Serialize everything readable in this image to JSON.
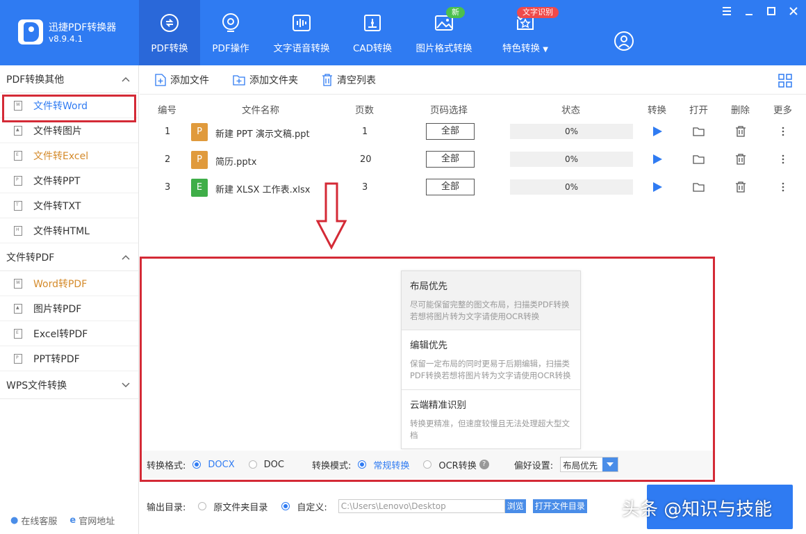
{
  "app": {
    "name": "迅捷PDF转换器",
    "version": "v8.9.4.1"
  },
  "nav": [
    {
      "label": "PDF转换",
      "icon": "pdf-convert-icon",
      "active": true
    },
    {
      "label": "PDF操作",
      "icon": "pdf-operate-icon"
    },
    {
      "label": "文字语音转换",
      "icon": "voice-wave-icon"
    },
    {
      "label": "CAD转换",
      "icon": "cad-icon"
    },
    {
      "label": "图片格式转换",
      "icon": "image-icon",
      "badge": "新"
    },
    {
      "label": "特色转换",
      "icon": "feature-icon",
      "badge": "文字识别"
    }
  ],
  "sidebar": {
    "group1": "PDF转换其他",
    "group1_items": [
      "文件转Word",
      "文件转图片",
      "文件转Excel",
      "文件转PPT",
      "文件转TXT",
      "文件转HTML"
    ],
    "group2": "文件转PDF",
    "group2_items": [
      "Word转PDF",
      "图片转PDF",
      "Excel转PDF",
      "PPT转PDF"
    ],
    "group3": "WPS文件转换",
    "bottom": {
      "service": "在线客服",
      "website": "官网地址"
    }
  },
  "toolbar": {
    "add_file": "添加文件",
    "add_folder": "添加文件夹",
    "clear": "清空列表"
  },
  "table": {
    "headers": [
      "编号",
      "文件名称",
      "页数",
      "页码选择",
      "状态",
      "转换",
      "打开",
      "删除",
      "更多"
    ],
    "rows": [
      {
        "no": "1",
        "type": "P",
        "name": "新建 PPT 演示文稿.ppt",
        "pages": "1",
        "range": "全部",
        "progress": "0%"
      },
      {
        "no": "2",
        "type": "P",
        "name": "简历.pptx",
        "pages": "20",
        "range": "全部",
        "progress": "0%"
      },
      {
        "no": "3",
        "type": "E",
        "name": "新建 XLSX 工作表.xlsx",
        "pages": "3",
        "range": "全部",
        "progress": "0%"
      }
    ]
  },
  "preference": {
    "options": [
      {
        "title": "布局优先",
        "desc": "尽可能保留完整的图文布局，扫描类PDF转换若想将图片转为文字请使用OCR转换"
      },
      {
        "title": "编辑优先",
        "desc": "保留一定布局的同时更易于后期编辑，扫描类PDF转换若想将图片转为文字请使用OCR转换"
      },
      {
        "title": "云端精准识别",
        "desc": "转换更精准，但速度较慢且无法处理超大型文档"
      }
    ]
  },
  "settings": {
    "format_label": "转换格式:",
    "format_docx": "DOCX",
    "format_doc": "DOC",
    "mode_label": "转换模式:",
    "mode_normal": "常规转换",
    "mode_ocr": "OCR转换",
    "pref_label": "偏好设置:",
    "pref_value": "布局优先"
  },
  "output": {
    "label": "输出目录:",
    "original": "原文件夹目录",
    "custom": "自定义:",
    "path": "C:\\Users\\Lenovo\\Desktop",
    "browse": "浏览",
    "open_dir": "打开文件目录"
  },
  "watermark": "头条 @知识与技能",
  "colors": {
    "primary": "#2f7bf2",
    "highlight": "#d42a36",
    "accent_orange": "#d48a2a"
  }
}
